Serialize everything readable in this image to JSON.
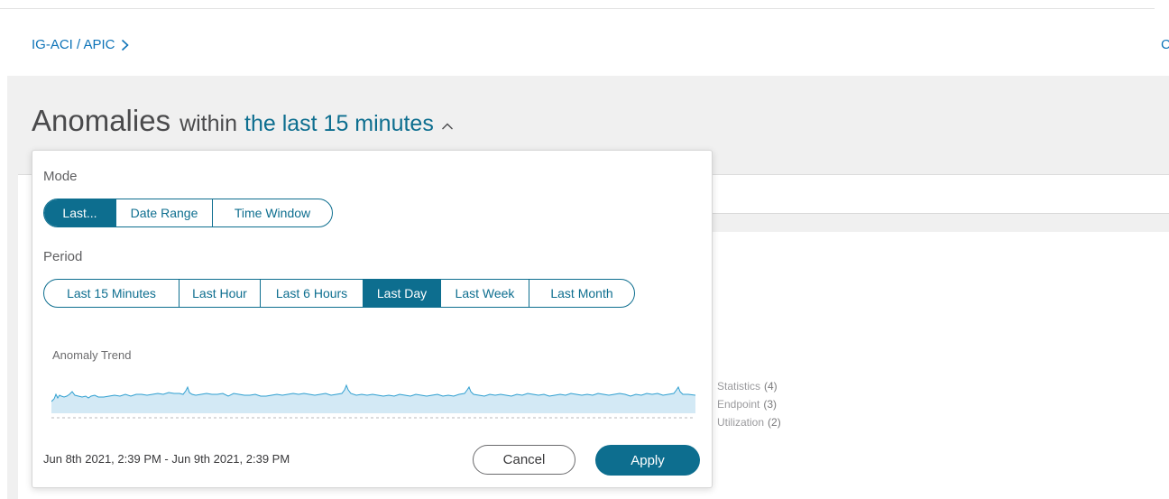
{
  "breadcrumb": {
    "text": "IG-ACI / APIC"
  },
  "header_right": {
    "text": "C"
  },
  "title": {
    "main": "Anomalies",
    "within": "within",
    "range": "the last 15 minutes"
  },
  "popover": {
    "mode_label": "Mode",
    "mode_options": [
      "Last...",
      "Date Range",
      "Time Window"
    ],
    "mode_selected": "Last...",
    "period_label": "Period",
    "period_options": [
      "Last 15 Minutes",
      "Last Hour",
      "Last 6 Hours",
      "Last Day",
      "Last Week",
      "Last Month"
    ],
    "period_selected": "Last Day",
    "trend_label": "Anomaly Trend",
    "date_range": "Jun 8th 2021, 2:39 PM - Jun 9th 2021, 2:39 PM",
    "cancel_label": "Cancel",
    "apply_label": "Apply"
  },
  "legend": [
    {
      "label": "Statistics",
      "count": "(4)"
    },
    {
      "label": "Endpoint",
      "count": "(3)"
    },
    {
      "label": "Utilization",
      "count": "(2)"
    }
  ],
  "colors": {
    "accent": "#0d6e8f",
    "link": "#0d73b8",
    "trend_fill": "#d3e9f5",
    "trend_line": "#2f9fd0"
  }
}
